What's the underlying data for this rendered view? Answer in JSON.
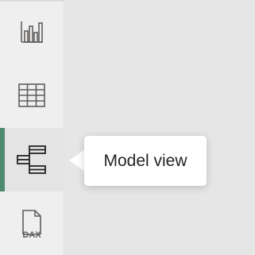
{
  "sidebar": {
    "items": [
      {
        "name": "report-view",
        "icon": "bar-chart-icon",
        "active": false
      },
      {
        "name": "data-view",
        "icon": "table-grid-icon",
        "active": false
      },
      {
        "name": "model-view",
        "icon": "model-diagram-icon",
        "active": true
      },
      {
        "name": "dax-query-view",
        "icon": "dax-file-icon",
        "active": false,
        "icon_text": "DAX"
      }
    ]
  },
  "tooltip": {
    "text": "Model view"
  },
  "colors": {
    "active_indicator": "#4d8a6f",
    "icon_stroke": "#605e5c",
    "rail_background": "#f0efef",
    "canvas_background": "#e6e6e6",
    "tooltip_background": "#ffffff"
  }
}
